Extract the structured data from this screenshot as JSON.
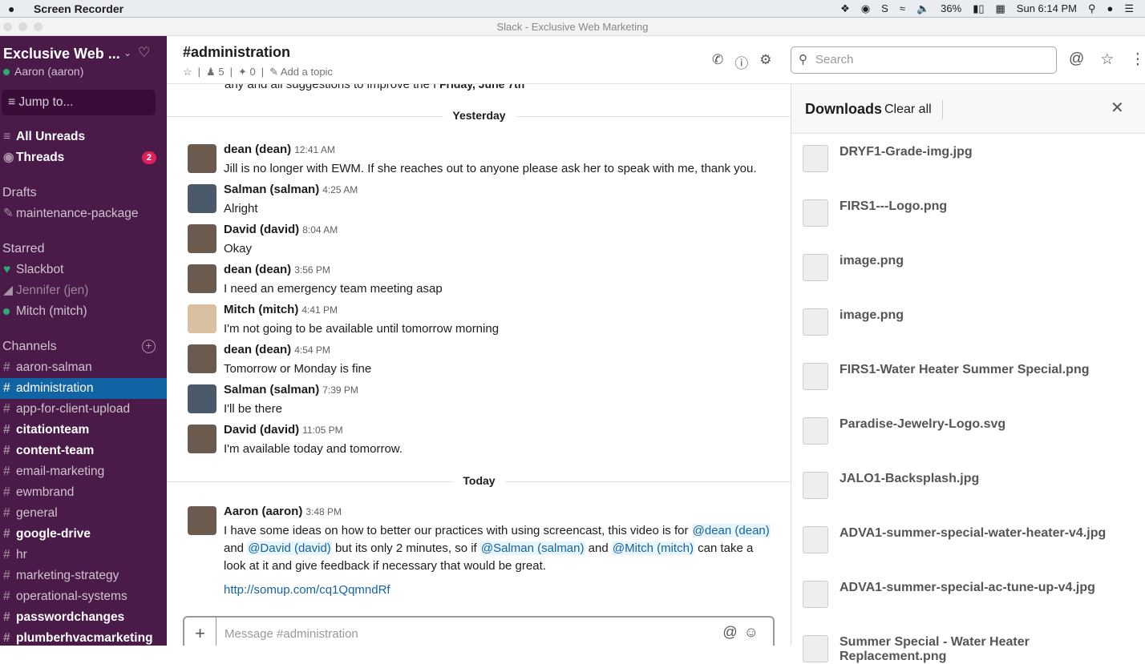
{
  "menubar": {
    "app": "Screen Recorder",
    "battery": "36%",
    "clock": "Sun 6:14 PM"
  },
  "window_title": "Slack - Exclusive Web Marketing",
  "sidebar": {
    "workspace": "Exclusive Web ...",
    "user": "Aaron (aaron)",
    "jump": "Jump to...",
    "all_unreads": "All Unreads",
    "threads": "Threads",
    "threads_badge": "2",
    "drafts_label": "Drafts",
    "drafts": [
      "maintenance-package"
    ],
    "starred_label": "Starred",
    "starred": [
      "Slackbot",
      "Jennifer (jen)",
      "Mitch (mitch)"
    ],
    "channels_label": "Channels",
    "channels": [
      {
        "name": "aaron-salman"
      },
      {
        "name": "administration"
      },
      {
        "name": "app-for-client-upload"
      },
      {
        "name": "citationteam"
      },
      {
        "name": "content-team"
      },
      {
        "name": "email-marketing"
      },
      {
        "name": "ewmbrand"
      },
      {
        "name": "general"
      },
      {
        "name": "google-drive"
      },
      {
        "name": "hr"
      },
      {
        "name": "marketing-strategy"
      },
      {
        "name": "operational-systems"
      },
      {
        "name": "passwordchanges"
      },
      {
        "name": "plumberhvacmarketing"
      }
    ]
  },
  "header": {
    "channel": "#administration",
    "members": "5",
    "pins": "0",
    "topic": "Add a topic",
    "search_placeholder": "Search"
  },
  "messages": {
    "scrolled_text": "any and all suggestions to improve the f",
    "float_date": "Friday, June 7th",
    "yesterday": "Yesterday",
    "today": "Today",
    "items": [
      {
        "author": "dean (dean)",
        "time": "12:41 AM",
        "text": "Jill is no longer with EWM. If she reaches out to anyone please ask her to speak with me, thank you."
      },
      {
        "author": "Salman (salman)",
        "time": "4:25 AM",
        "text": "Alright"
      },
      {
        "author": "David (david)",
        "time": "8:04 AM",
        "text": "Okay"
      },
      {
        "author": "dean (dean)",
        "time": "3:56 PM",
        "text": "I need an emergency team meeting asap"
      },
      {
        "author": "Mitch (mitch)",
        "time": "4:41 PM",
        "text": "I'm not going to be available until tomorrow morning"
      },
      {
        "author": "dean (dean)",
        "time": "4:54 PM",
        "text": "Tomorrow or Monday is fine"
      },
      {
        "author": "Salman (salman)",
        "time": "7:39 PM",
        "text": "I'll be there"
      },
      {
        "author": "David (david)",
        "time": "11:05 PM",
        "text": "I'm available today and tomorrow."
      }
    ],
    "last": {
      "author": "Aaron (aaron)",
      "time": "3:48 PM",
      "t1": "I have some ideas on how to better our practices with using screencast, this video is for ",
      "m1": "@dean (dean)",
      "t2": " and ",
      "m2": "@David (david)",
      "t3": " but its only 2 minutes, so if ",
      "m3": "@Salman (salman)",
      "t4": " and ",
      "m4": "@Mitch (mitch)",
      "t5": " can take a look at it and give feedback if necessary that would be great.",
      "link": "http://somup.com/cq1QqmndRf"
    },
    "composer_placeholder": "Message #administration"
  },
  "downloads": {
    "title": "Downloads",
    "clear": "Clear all",
    "files": [
      "DRYF1-Grade-img.jpg",
      "FIRS1---Logo.png",
      "image.png",
      "image.png",
      "FIRS1-Water Heater Summer Special.png",
      "Paradise-Jewelry-Logo.svg",
      "JALO1-Backsplash.jpg",
      "ADVA1-summer-special-water-heater-v4.jpg",
      "ADVA1-summer-special-ac-tune-up-v4.jpg",
      "Summer Special - Water Heater Replacement.png"
    ]
  }
}
